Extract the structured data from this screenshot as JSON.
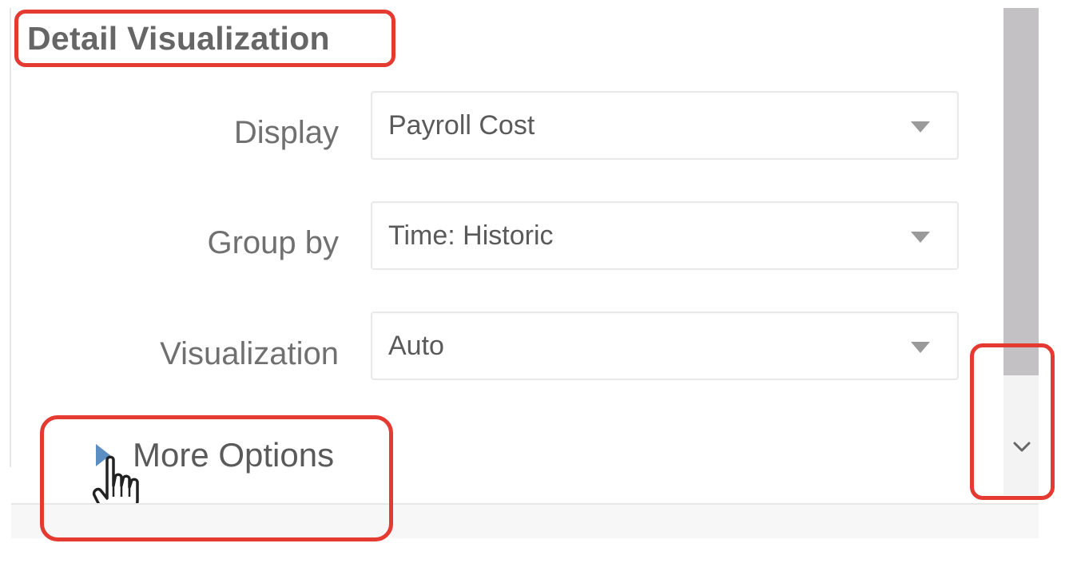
{
  "section": {
    "title": "Detail Visualization"
  },
  "fields": [
    {
      "label": "Display",
      "value": "Payroll Cost"
    },
    {
      "label": "Group by",
      "value": "Time: Historic"
    },
    {
      "label": "Visualization",
      "value": "Auto"
    }
  ],
  "more_options": {
    "label": "More Options"
  },
  "icons": {
    "dropdown": "caret-down-icon",
    "expand": "triangle-right-icon",
    "scroll_down": "chevron-down-icon",
    "cursor": "hand-pointer-cursor"
  },
  "colors": {
    "highlight": "#e53a32",
    "expand_triangle": "#5b8fc4",
    "scroll_thumb": "#c4c1c4"
  }
}
